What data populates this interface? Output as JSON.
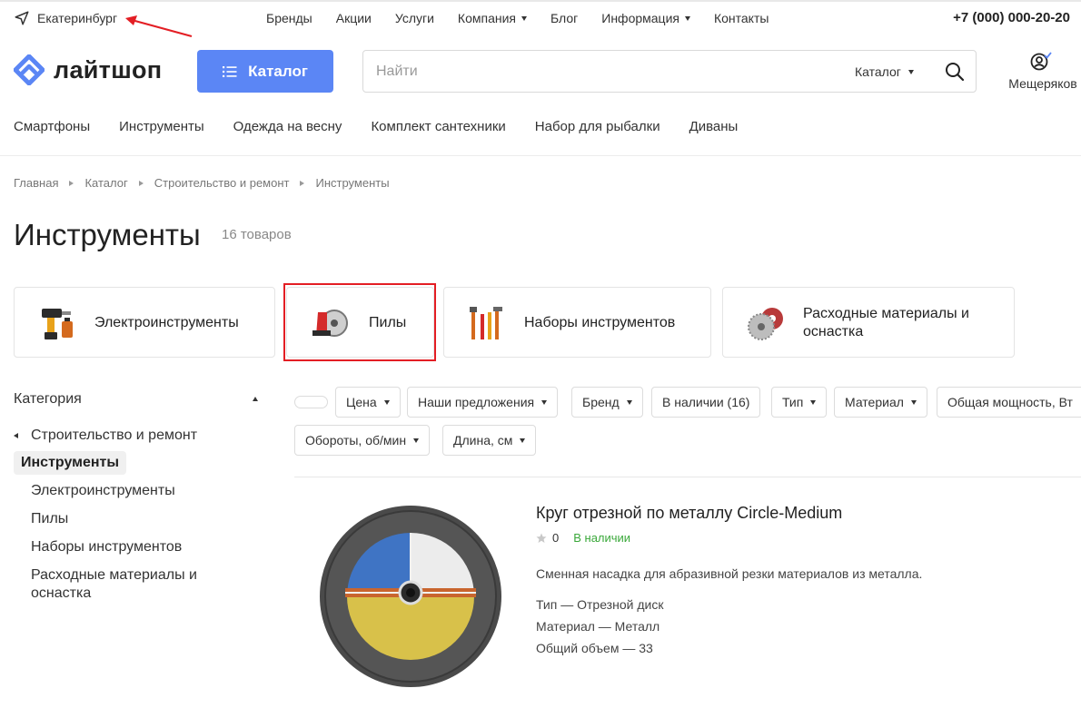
{
  "header": {
    "city": "Екатеринбург",
    "nav": [
      {
        "label": "Бренды",
        "dropdown": false
      },
      {
        "label": "Акции",
        "dropdown": false
      },
      {
        "label": "Услуги",
        "dropdown": false
      },
      {
        "label": "Компания",
        "dropdown": true
      },
      {
        "label": "Блог",
        "dropdown": false
      },
      {
        "label": "Информация",
        "dropdown": true
      },
      {
        "label": "Контакты",
        "dropdown": false
      }
    ],
    "phone": "+7 (000) 000-20-20",
    "logo_text": "лайтшоп",
    "catalog_button": "Каталог",
    "search": {
      "placeholder": "Найти",
      "scope": "Каталог"
    },
    "user_name": "Мещеряков"
  },
  "quick_nav": [
    "Смартфоны",
    "Инструменты",
    "Одежда на весну",
    "Комплект сантехники",
    "Набор для рыбалки",
    "Диваны"
  ],
  "breadcrumb": [
    "Главная",
    "Каталог",
    "Строительство и ремонт",
    "Инструменты"
  ],
  "page": {
    "title": "Инструменты",
    "count": "16 товаров"
  },
  "category_tiles": [
    {
      "label": "Электроинструменты",
      "icon": "power-drill-icon"
    },
    {
      "label": "Пилы",
      "icon": "circular-saw-icon"
    },
    {
      "label": "Наборы инструментов",
      "icon": "tool-set-icon"
    },
    {
      "label": "Расходные материалы и оснастка",
      "icon": "saw-blade-icon"
    }
  ],
  "sidebar": {
    "heading": "Категория",
    "parent": "Строительство и ремонт",
    "active": "Инструменты",
    "children": [
      "Электроинструменты",
      "Пилы",
      "Наборы инструментов",
      "Расходные материалы и оснастка"
    ]
  },
  "filters": [
    "Цена",
    "Наши предложения",
    "Бренд",
    "В наличии (16)",
    "Тип",
    "Материал",
    "Общая мощность, Вт",
    "Обороты, об/мин",
    "Длина, см"
  ],
  "product": {
    "title": "Круг отрезной по металлу Circle-Medium",
    "rating": "0",
    "stock": "В наличии",
    "description": "Сменная насадка для абразивной резки материалов из металла.",
    "properties": [
      "Тип — Отрезной диск",
      "Материал — Металл",
      "Общий объем — 33"
    ]
  },
  "colors": {
    "accent": "#5b86f5",
    "annotation": "#e31e24",
    "in_stock": "#3aa83a"
  }
}
